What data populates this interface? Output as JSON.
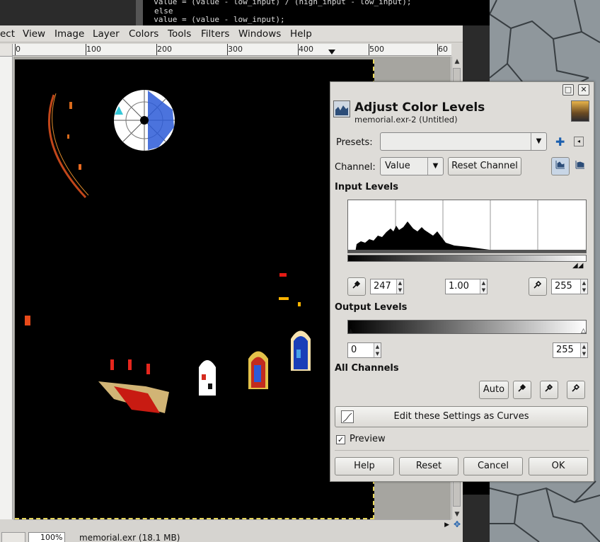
{
  "terminal": {
    "lines": [
      "  value = (value - low_input) / (high_input - low_input);",
      "else",
      "  value = (value - low_input);"
    ]
  },
  "menubar": {
    "items": [
      "ect",
      "View",
      "Image",
      "Layer",
      "Colors",
      "Tools",
      "Filters",
      "Windows",
      "Help"
    ]
  },
  "ruler": {
    "labels": [
      "0",
      "100",
      "200",
      "300",
      "400",
      "500",
      "60"
    ]
  },
  "statusbar": {
    "zoom": "100%",
    "info": "memorial.exr (18.1 MB)"
  },
  "dialog": {
    "title": "Adjust Color Levels",
    "subtitle": "memorial.exr-2 (Untitled)",
    "presets_label": "Presets:",
    "presets_value": "",
    "channel_label": "Channel:",
    "channel_value": "Value",
    "reset_channel": "Reset Channel",
    "input_levels_heading": "Input Levels",
    "input_low": "247",
    "input_gamma": "1.00",
    "input_high": "255",
    "output_levels_heading": "Output Levels",
    "output_low": "0",
    "output_high": "255",
    "all_channels_heading": "All Channels",
    "auto": "Auto",
    "edit_curves": "Edit these Settings as Curves",
    "preview_label": "Preview",
    "preview_checked": true,
    "buttons": {
      "help": "Help",
      "reset": "Reset",
      "cancel": "Cancel",
      "ok": "OK"
    }
  },
  "colors": {
    "accent": "#1c5fae",
    "dialog_bg": "#dedcd8",
    "canvas_bg": "#a6a5a0"
  }
}
